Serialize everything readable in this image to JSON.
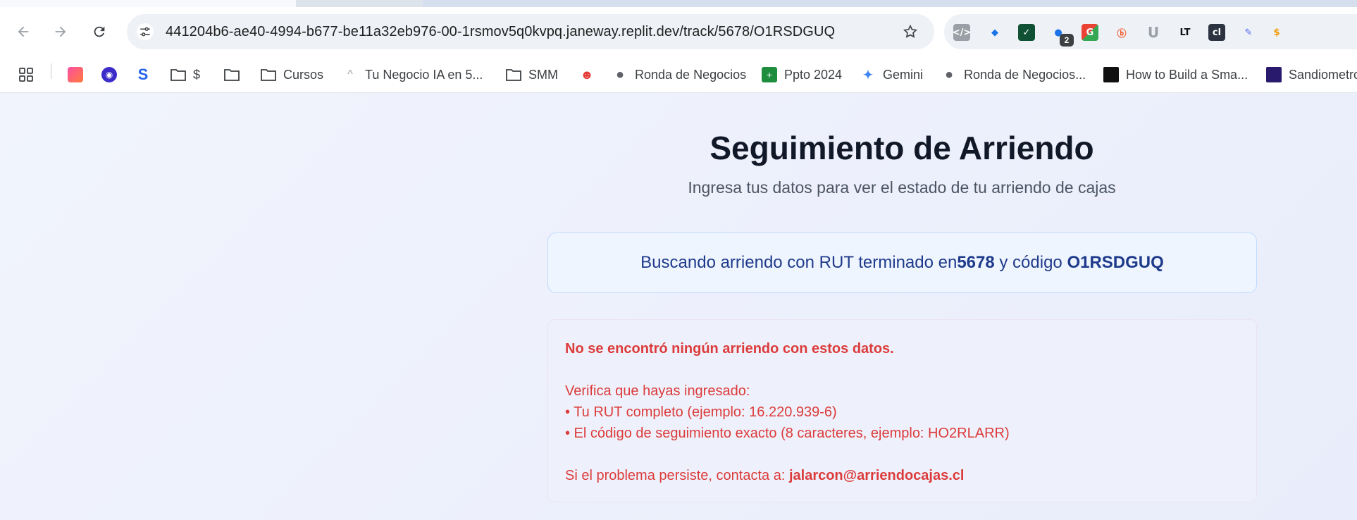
{
  "browser": {
    "url": "441204b6-ae40-4994-b677-be11a32eb976-00-1rsmov5q0kvpq.janeway.replit.dev/track/5678/O1RSDGUQ",
    "extension_badge": "2"
  },
  "bookmarks": [
    {
      "label": "",
      "icon": "apps-grid-icon"
    },
    {
      "label": "",
      "icon": "gradient-app-icon"
    },
    {
      "label": "",
      "icon": "location-pin-icon"
    },
    {
      "label": "",
      "icon": "s-logo-icon"
    },
    {
      "label": "$",
      "icon": "folder-icon"
    },
    {
      "label": "",
      "icon": "folder-icon"
    },
    {
      "label": "Cursos",
      "icon": "folder-icon"
    },
    {
      "label": "Tu Negocio IA en 5...",
      "icon": "caret-icon"
    },
    {
      "label": "SMM",
      "icon": "folder-icon"
    },
    {
      "label": "",
      "icon": "red-mask-icon"
    },
    {
      "label": "Ronda de Negocios",
      "icon": "globe-icon"
    },
    {
      "label": "Ppto 2024",
      "icon": "sheets-icon"
    },
    {
      "label": "Gemini",
      "icon": "gemini-icon"
    },
    {
      "label": "Ronda de Negocios...",
      "icon": "globe-icon"
    },
    {
      "label": "How to Build a Sma...",
      "icon": "dark-thumbnail-icon"
    },
    {
      "label": "Sandiometro",
      "icon": "purple-thumbnail-icon"
    }
  ],
  "page": {
    "title": "Seguimiento de Arriendo",
    "subtitle": "Ingresa tus datos para ver el estado de tu arriendo de cajas",
    "search": {
      "prefix": "Buscando arriendo con RUT terminado en ",
      "rut": "5678",
      "middle": " y código ",
      "code": "O1RSDGUQ"
    },
    "error": {
      "title": "No se encontró ningún arriendo con estos datos.",
      "verify": "Verifica que hayas ingresado:",
      "bullet1": "• Tu RUT completo (ejemplo: 16.220.939-6)",
      "bullet2": "• El código de seguimiento exacto (8 caracteres, ejemplo: HO2RLARR)",
      "contact_prefix": "Si el problema persiste, contacta a: ",
      "email": "jalarcon@arriendocajas.cl"
    }
  },
  "colors": {
    "title": "#111827",
    "search_text": "#1e3a8a",
    "error_text": "#dc3b3b",
    "page_bg": "#eef2fb"
  }
}
